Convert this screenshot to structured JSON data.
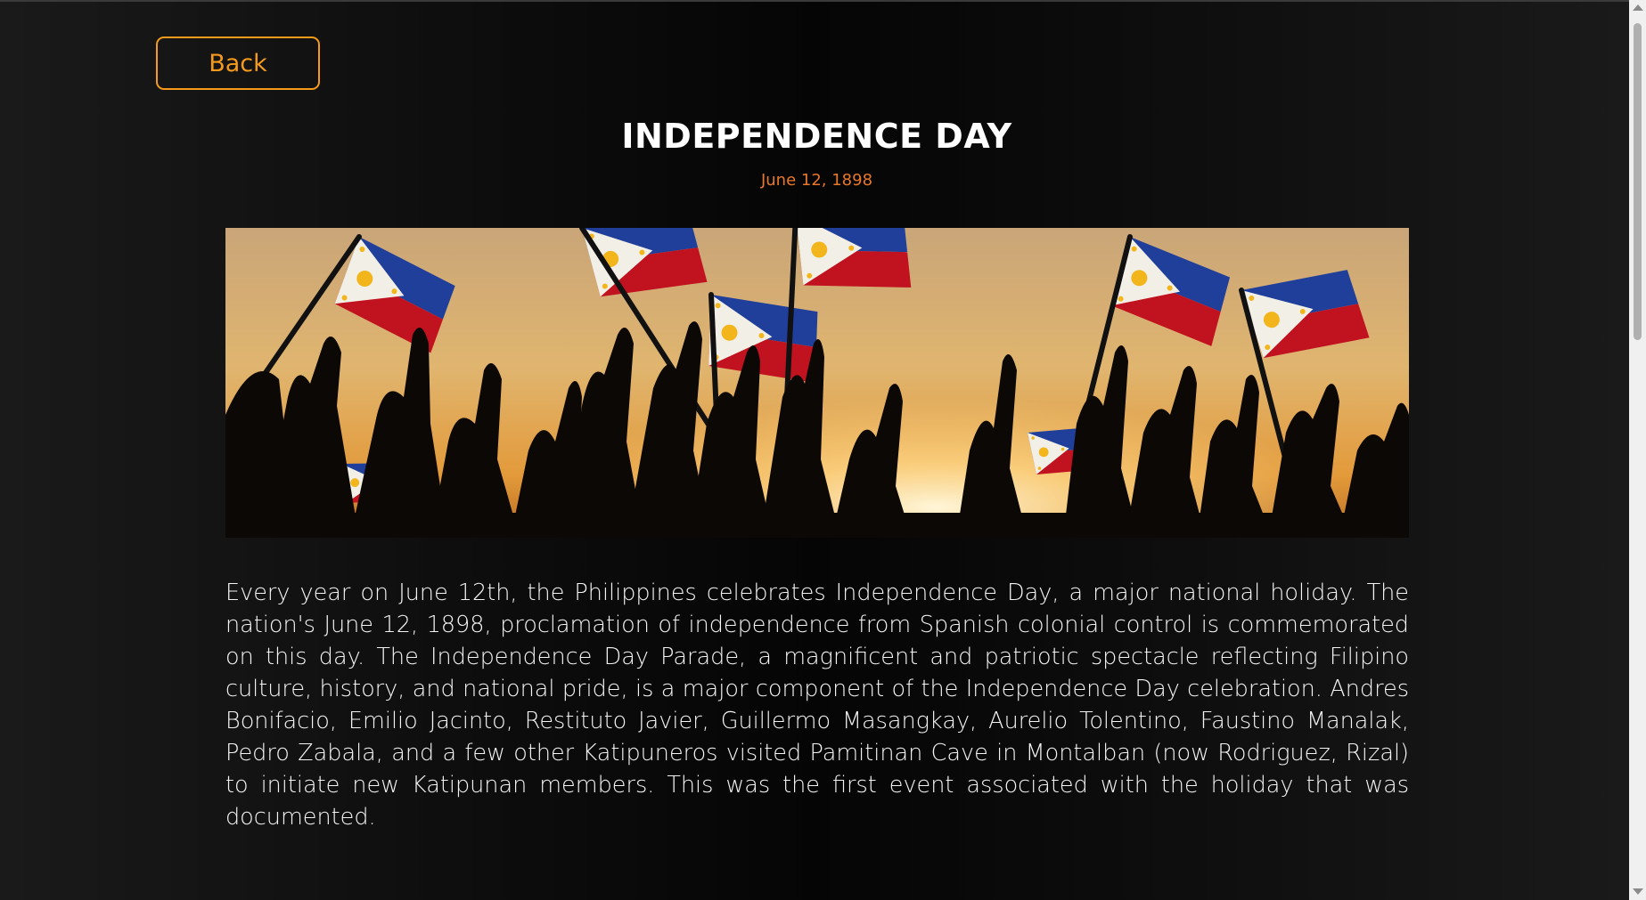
{
  "nav": {
    "back_label": "Back"
  },
  "article": {
    "title": "INDEPENDENCE DAY",
    "date": "June 12, 1898",
    "body": "Every year on June 12th, the Philippines celebrates Independence Day, a major national holiday. The nation's June 12, 1898, proclamation of independence from Spanish colonial control is commemorated on this day. The Independence Day Parade, a magnificent and patriotic spectacle reflecting Filipino culture, history, and national pride, is a major component of the Independence Day celebration. Andres Bonifacio, Emilio Jacinto, Restituto Javier, Guillermo Masangkay, Aurelio Tolentino, Faustino Manalak, Pedro Zabala, and a few other Katipuneros visited Pamitinan Cave in Montalban (now Rodriguez, Rizal) to initiate new Katipunan members. This was the first event associated with the holiday that was documented."
  },
  "hero_image": {
    "description_icon": "crowd-waving-philippine-flags-image"
  },
  "colors": {
    "accent": "#f59a1b",
    "date": "#e8772a",
    "background": "#0b0b0b",
    "text": "#ffffff"
  }
}
